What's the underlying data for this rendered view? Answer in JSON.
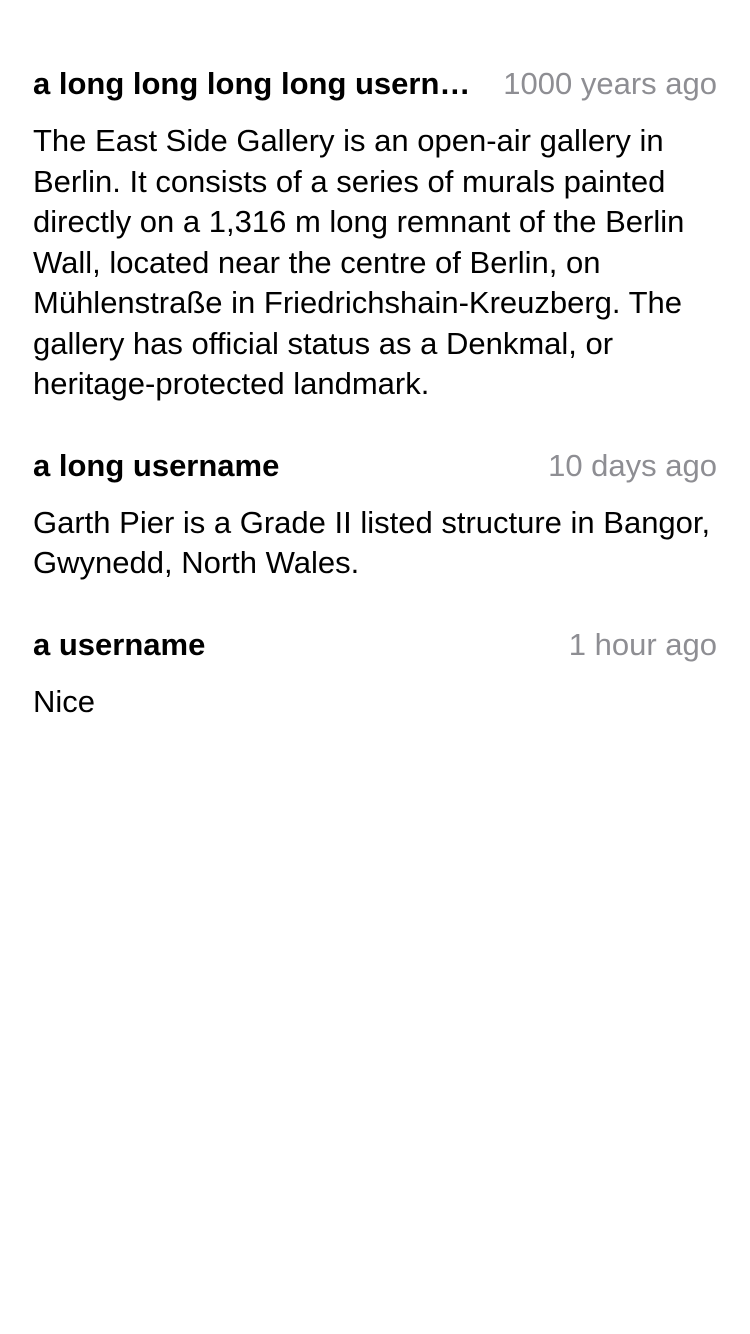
{
  "comments": [
    {
      "username": "a long long long long username",
      "timestamp": "1000 years ago",
      "text": "The East Side Gallery is an open-air gallery in Berlin. It consists of a series of murals painted directly on a 1,316 m long remnant of the Berlin Wall, located near the centre of Berlin, on Mühlenstraße in Friedrichshain-Kreuzberg. The gallery has official status as a Denkmal, or heritage-protected landmark."
    },
    {
      "username": "a long username",
      "timestamp": "10 days ago",
      "text": "Garth Pier is a Grade II listed structure in Bangor, Gwynedd, North Wales."
    },
    {
      "username": "a username",
      "timestamp": "1 hour ago",
      "text": "Nice"
    }
  ]
}
